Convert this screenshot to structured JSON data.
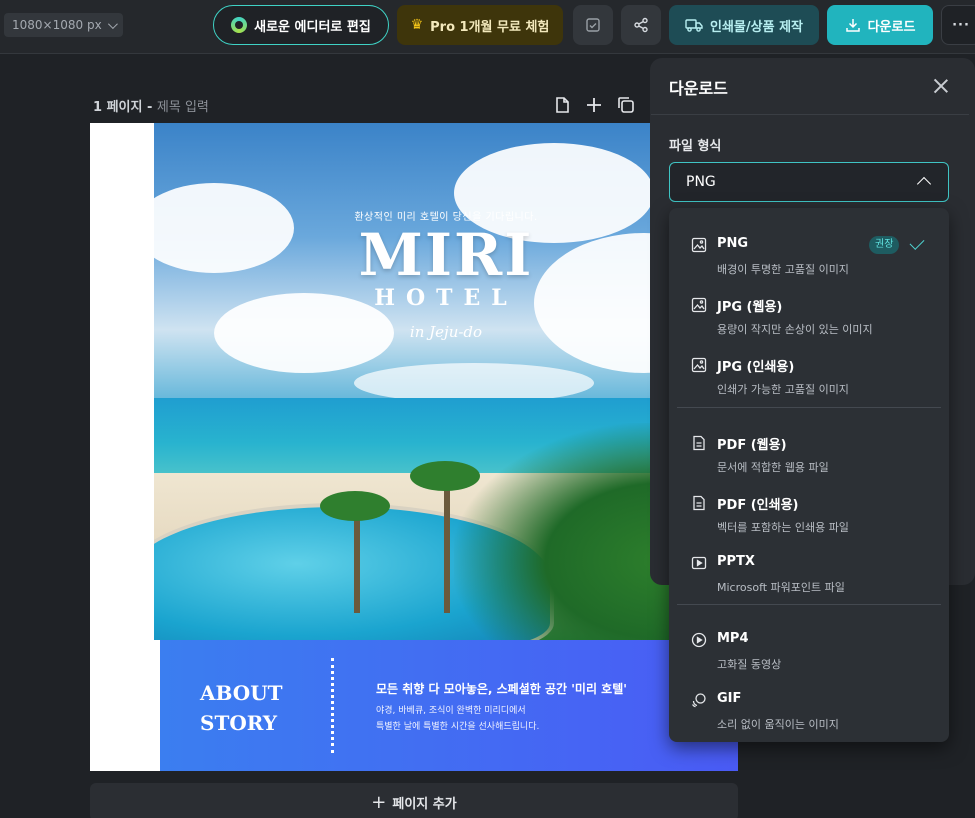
{
  "toolbar": {
    "canvas_size": "1080×1080 px",
    "new_editor_label": "새로운 에디터로 편집",
    "pro_trial_label": "Pro 1개월 무료 체험",
    "print_label": "인쇄물/상품 제작",
    "download_label": "다운로드",
    "more_label": "···"
  },
  "page": {
    "number_label": "1 페이지",
    "separator": "-",
    "title_placeholder": "제목 입력",
    "add_page_label": "페이지 추가"
  },
  "design": {
    "tagline": "환상적인 미리 호텔이 당신을 기다립니다.",
    "brand": "MIRI",
    "subbrand": "HOTEL",
    "location": "in Jeju-do",
    "about_title_line1": "ABOUT",
    "about_title_line2": "STORY",
    "about_heading": "모든 취향 다 모아놓은, 스페셜한 공간 '미리 호텔'",
    "about_body_line1": "야경, 바베큐, 조식이 완벽한 미리디에서",
    "about_body_line2": "특별한 날에 특별한 시간을 선사해드립니다."
  },
  "download_panel": {
    "title": "다운로드",
    "format_label": "파일 형식",
    "selected_format": "PNG",
    "options": [
      {
        "name": "PNG",
        "desc": "배경이 투명한 고품질 이미지",
        "badge": "권장",
        "selected": true,
        "icon": "image-icon"
      },
      {
        "name": "JPG (웹용)",
        "desc": "용량이 작지만 손상이 있는 이미지",
        "icon": "image-icon"
      },
      {
        "name": "JPG (인쇄용)",
        "desc": "인쇄가 가능한 고품질 이미지",
        "icon": "image-icon"
      },
      {
        "name": "PDF (웹용)",
        "desc": "문서에 적합한 웹용 파일",
        "icon": "document-icon"
      },
      {
        "name": "PDF (인쇄용)",
        "desc": "벡터를 포함하는 인쇄용 파일",
        "icon": "document-icon"
      },
      {
        "name": "PPTX",
        "desc": "Microsoft 파워포인트 파일",
        "icon": "presentation-icon"
      },
      {
        "name": "MP4",
        "desc": "고화질 동영상",
        "icon": "play-circle-icon"
      },
      {
        "name": "GIF",
        "desc": "소리 없이 움직이는 이미지",
        "icon": "gif-loop-icon"
      }
    ]
  },
  "colors": {
    "accent": "#21b4be",
    "select_border": "#3fc4c4",
    "about_gradient_start": "#3b7ef0",
    "about_gradient_end": "#4a5bf5"
  }
}
